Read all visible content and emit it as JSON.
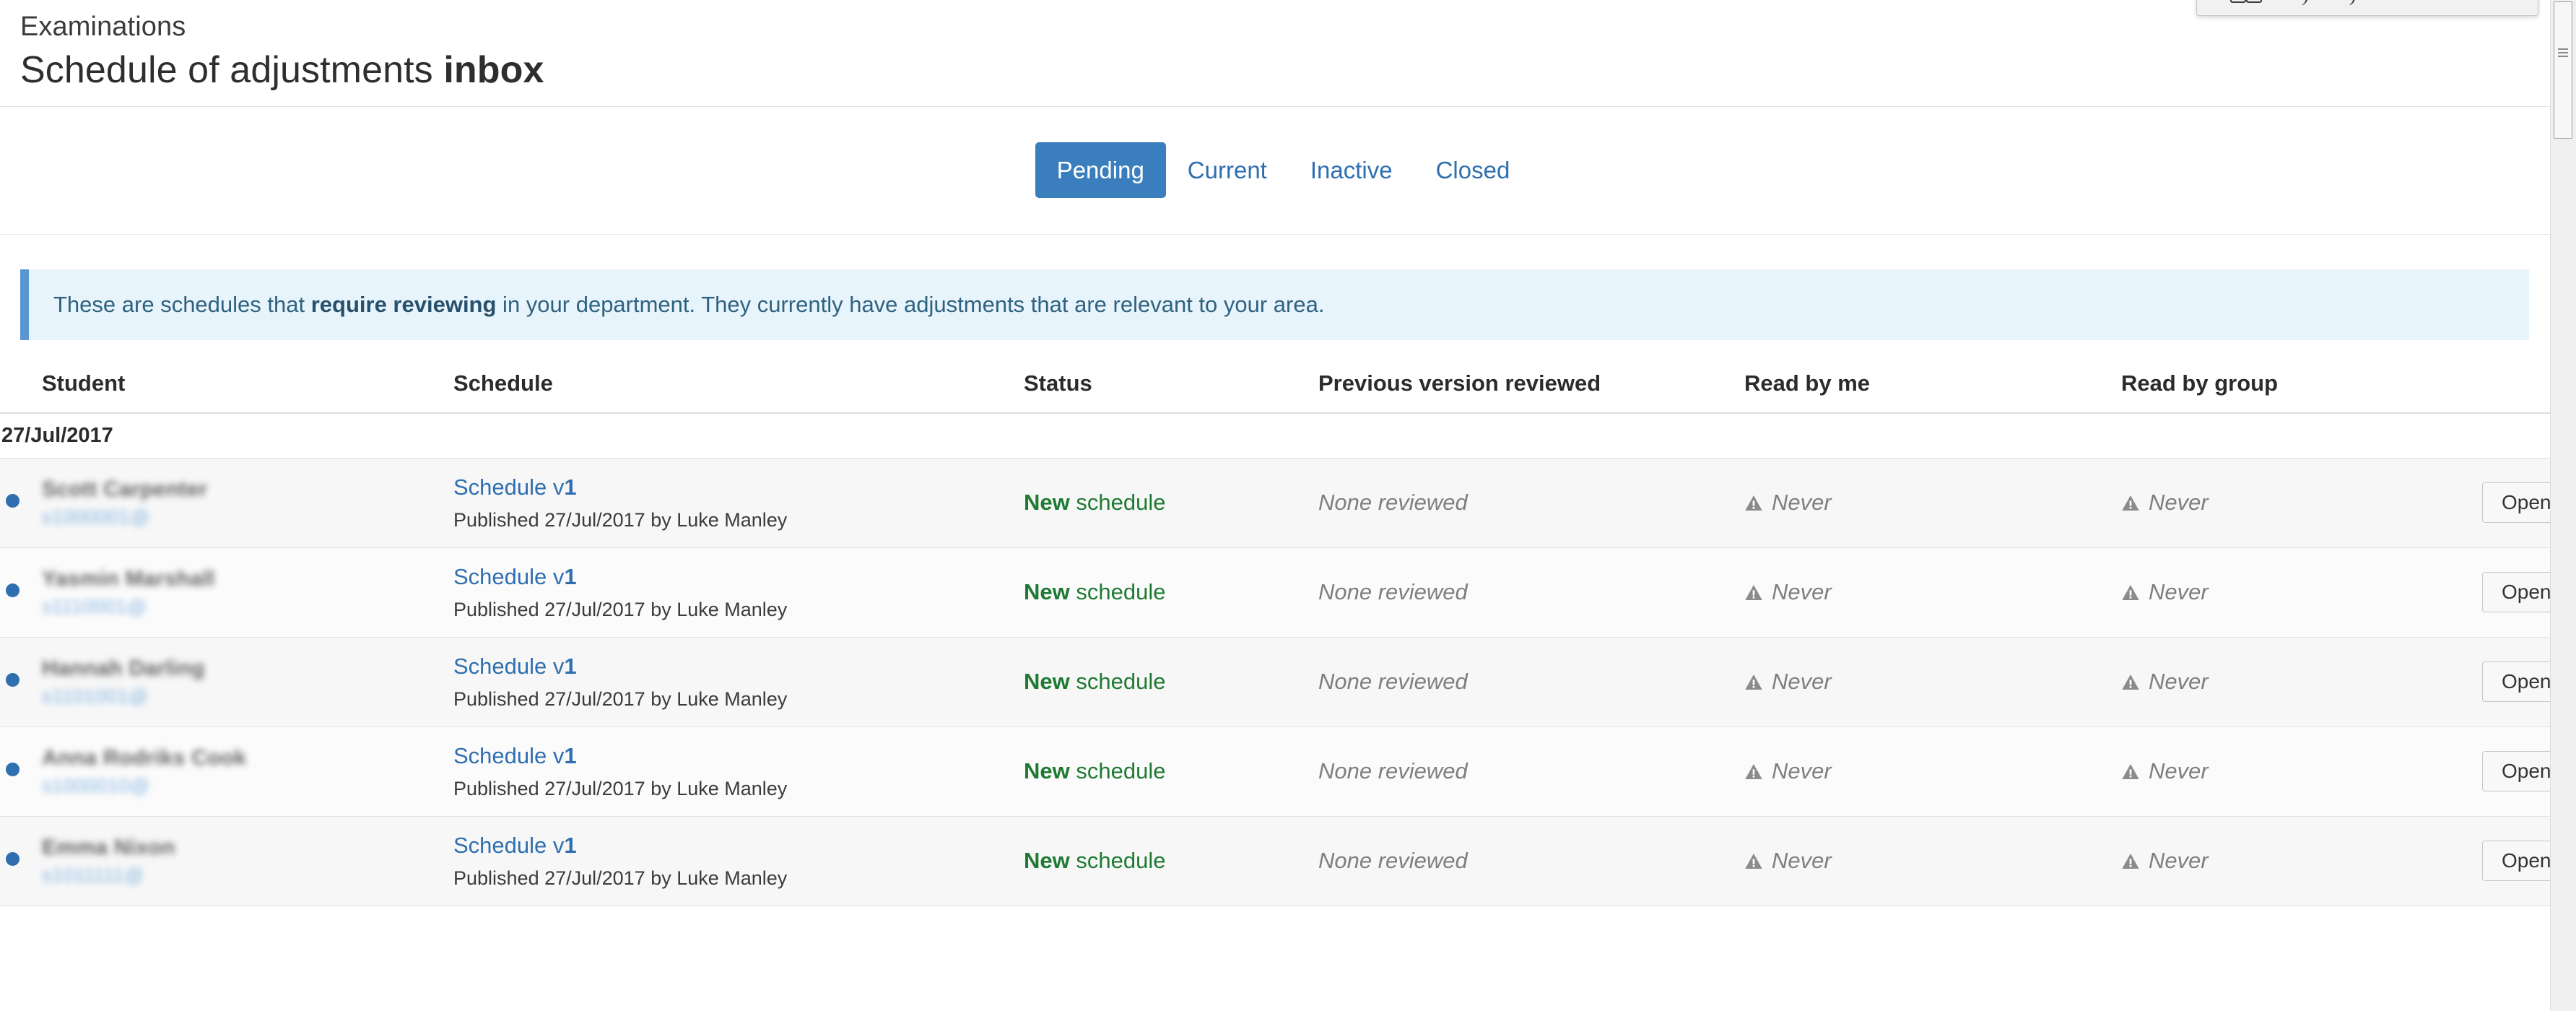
{
  "window": {
    "scrollbar": {
      "name": "vertical-scrollbar"
    },
    "float_toolbar": {
      "glasses_icon": "glasses-icon",
      "hook_icon_left": "curve-hook-icon",
      "hook_icon_right": "curve-hook-icon",
      "slider_icon": "zoom-slider"
    }
  },
  "header": {
    "eyebrow": "Examinations",
    "title_regular": "Schedule of adjustments ",
    "title_bold": "inbox"
  },
  "tabs": [
    {
      "label": "Pending",
      "active": true
    },
    {
      "label": "Current",
      "active": false
    },
    {
      "label": "Inactive",
      "active": false
    },
    {
      "label": "Closed",
      "active": false
    }
  ],
  "banner": {
    "text_before": "These are schedules that ",
    "text_bold": "require reviewing",
    "text_after": " in your department. They currently have adjustments that are relevant to your area."
  },
  "table": {
    "columns": [
      "Student",
      "Schedule",
      "Status",
      "Previous version reviewed",
      "Read by me",
      "Read by group"
    ],
    "group_date": "27/Jul/2017",
    "open_label": "Open",
    "rows": [
      {
        "student_name": "Scott Carpenter",
        "student_id": "s1000001@",
        "schedule_link": "Schedule v",
        "schedule_version": "1",
        "schedule_meta": "Published 27/Jul/2017 by Luke Manley",
        "status_bold": "New",
        "status_rest": " schedule",
        "previous_reviewed": "None reviewed",
        "read_by_me": "Never",
        "read_by_group": "Never"
      },
      {
        "student_name": "Yasmin Marshall",
        "student_id": "s1110001@",
        "schedule_link": "Schedule v",
        "schedule_version": "1",
        "schedule_meta": "Published 27/Jul/2017 by Luke Manley",
        "status_bold": "New",
        "status_rest": " schedule",
        "previous_reviewed": "None reviewed",
        "read_by_me": "Never",
        "read_by_group": "Never"
      },
      {
        "student_name": "Hannah Darling",
        "student_id": "s1101001@",
        "schedule_link": "Schedule v",
        "schedule_version": "1",
        "schedule_meta": "Published 27/Jul/2017 by Luke Manley",
        "status_bold": "New",
        "status_rest": " schedule",
        "previous_reviewed": "None reviewed",
        "read_by_me": "Never",
        "read_by_group": "Never"
      },
      {
        "student_name": "Anna Rodriks Cook",
        "student_id": "s1000010@",
        "schedule_link": "Schedule v",
        "schedule_version": "1",
        "schedule_meta": "Published 27/Jul/2017 by Luke Manley",
        "status_bold": "New",
        "status_rest": " schedule",
        "previous_reviewed": "None reviewed",
        "read_by_me": "Never",
        "read_by_group": "Never"
      },
      {
        "student_name": "Emma Nixon",
        "student_id": "s1011111@",
        "schedule_link": "Schedule v",
        "schedule_version": "1",
        "schedule_meta": "Published 27/Jul/2017 by Luke Manley",
        "status_bold": "New",
        "status_rest": " schedule",
        "previous_reviewed": "None reviewed",
        "read_by_me": "Never",
        "read_by_group": "Never"
      }
    ]
  },
  "colors": {
    "accent_blue": "#3a7ebd",
    "link_blue": "#2f6fb0",
    "banner_bg": "#e8f4fb",
    "banner_border": "#5a96d2",
    "status_green": "#1e7a32",
    "muted_gray": "#7e7e7e",
    "row_bg": "#f7f7f7"
  }
}
